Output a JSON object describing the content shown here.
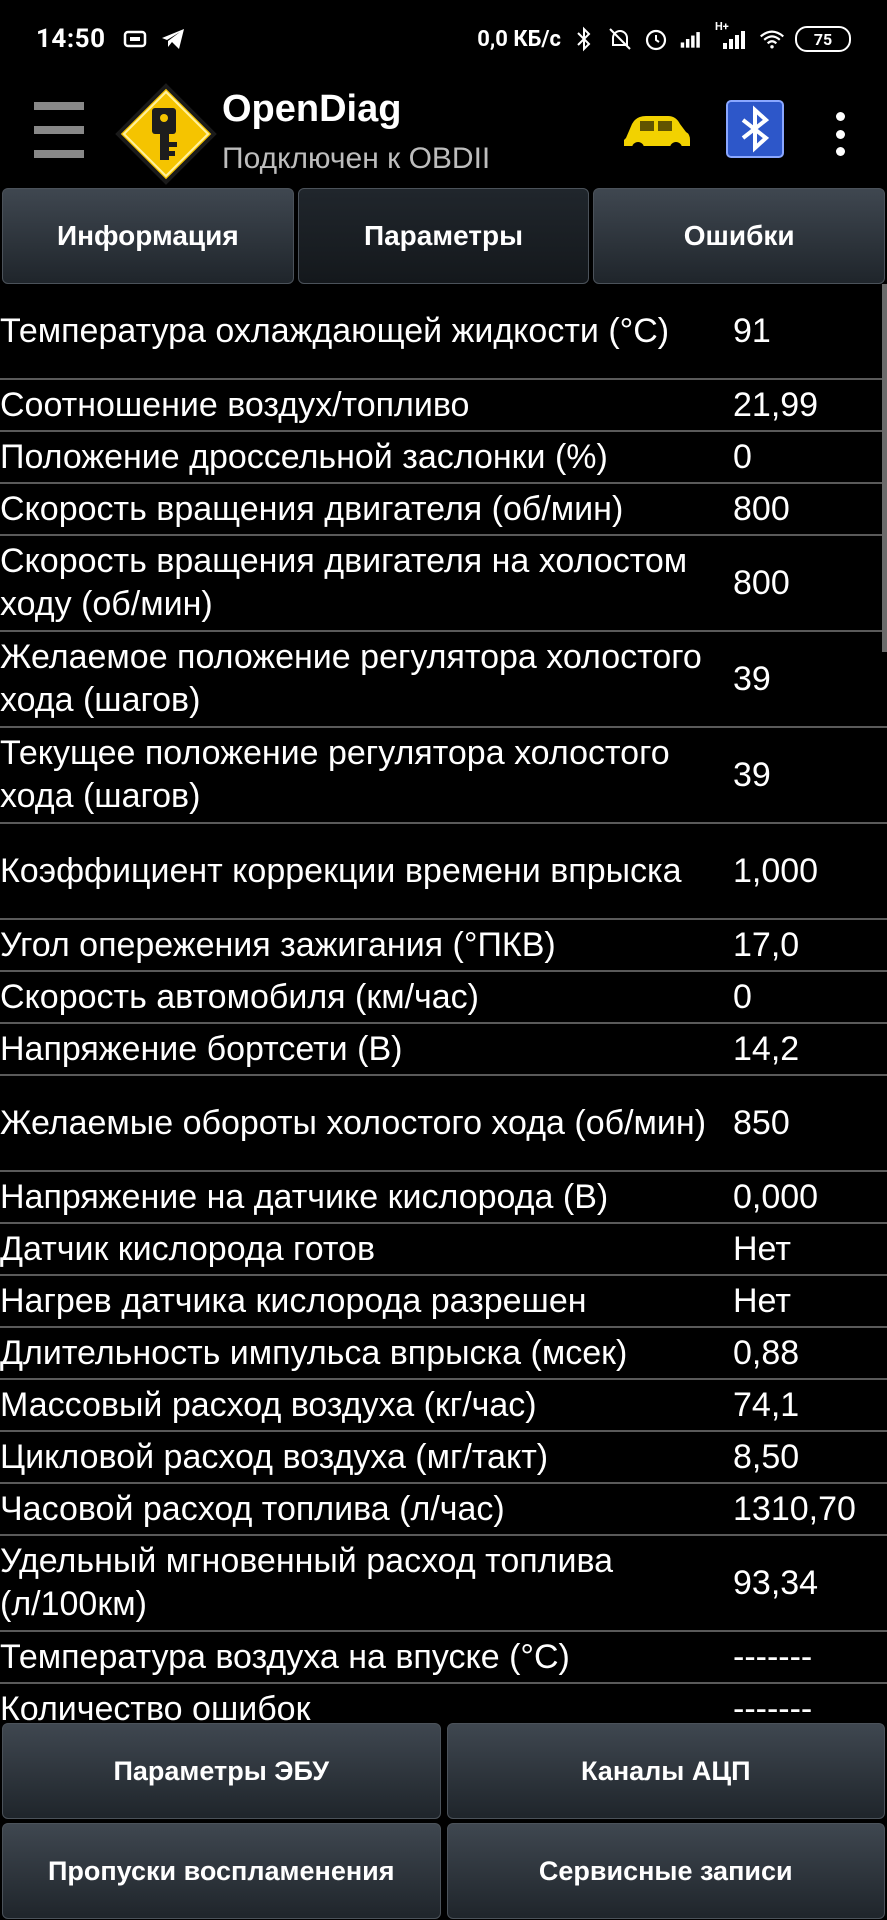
{
  "status_bar": {
    "time": "14:50",
    "net_speed": "0,0 КБ/с",
    "network_type": "H+",
    "battery": "75"
  },
  "action_bar": {
    "title": "OpenDiag",
    "subtitle": "Подключен к OBDII"
  },
  "tabs": [
    {
      "label": "Информация"
    },
    {
      "label": "Параметры"
    },
    {
      "label": "Ошибки"
    }
  ],
  "parameters": [
    {
      "name": "Температура охлаждающей жидкости (°C)",
      "value": "91"
    },
    {
      "name": "Соотношение воздух/топливо",
      "value": "21,99"
    },
    {
      "name": "Положение дроссельной заслонки (%)",
      "value": "0"
    },
    {
      "name": "Скорость вращения двигателя (об/мин)",
      "value": "800"
    },
    {
      "name": "Скорость вращения двигателя на холостом ходу (об/мин)",
      "value": "800"
    },
    {
      "name": "Желаемое положение регулятора холостого хода (шагов)",
      "value": "39"
    },
    {
      "name": "Текущее положение регулятора холостого хода (шагов)",
      "value": "39"
    },
    {
      "name": "Коэффициент коррекции времени впрыска",
      "value": "1,000"
    },
    {
      "name": "Угол опережения зажигания (°ПКВ)",
      "value": "17,0"
    },
    {
      "name": "Скорость автомобиля (км/час)",
      "value": "0"
    },
    {
      "name": "Напряжение бортсети (В)",
      "value": "14,2"
    },
    {
      "name": "Желаемые обороты холостого хода (об/мин)",
      "value": "850"
    },
    {
      "name": "Напряжение на датчике кислорода (В)",
      "value": "0,000"
    },
    {
      "name": "Датчик кислорода готов",
      "value": "Нет"
    },
    {
      "name": "Нагрев датчика кислорода разрешен",
      "value": "Нет"
    },
    {
      "name": "Длительность импульса впрыска (мсек)",
      "value": "0,88"
    },
    {
      "name": "Массовый расход воздуха (кг/час)",
      "value": "74,1"
    },
    {
      "name": "Цикловой расход воздуха (мг/такт)",
      "value": "8,50"
    },
    {
      "name": "Часовой расход топлива (л/час)",
      "value": "1310,70"
    },
    {
      "name": "Удельный мгновенный расход топлива (л/100км)",
      "value": "93,34"
    },
    {
      "name": "Температура воздуха на впуске (°C)",
      "value": "-------"
    },
    {
      "name": "Количество ошибок",
      "value": "-------"
    }
  ],
  "bottom_buttons": [
    {
      "label": "Параметры ЭБУ"
    },
    {
      "label": "Каналы АЦП"
    },
    {
      "label": "Пропуски воспламенения"
    },
    {
      "label": "Сервисные записи"
    }
  ],
  "colors": {
    "background": "#000000",
    "divider": "#5a5a5a",
    "button_top": "#3f4750",
    "button_bottom": "#1f252b",
    "logo_yellow": "#f5c400",
    "car_yellow": "#f2d200",
    "bluetooth_blue": "#2d57c9"
  }
}
